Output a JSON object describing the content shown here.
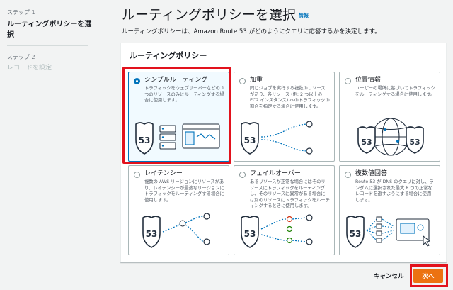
{
  "sidebar": {
    "steps": [
      {
        "label": "ステップ 1",
        "name": "ルーティングポリシーを選択"
      },
      {
        "label": "ステップ 2",
        "name": "レコードを設定"
      }
    ]
  },
  "header": {
    "title": "ルーティングポリシーを選択",
    "info": "情報",
    "description": "ルーティングポリシーは、Amazon Route 53 がどのようにクエリに応答するかを決定します。"
  },
  "panel": {
    "title": "ルーティングポリシー",
    "badge": "53",
    "options": [
      {
        "title": "シンプルルーティング",
        "description": "トラフィックをウェブサーバーなどの 1 つのリソースのみにルーティングする場合に使用します。",
        "selected": true
      },
      {
        "title": "加重",
        "description": "同じジョブを実行する複数のリソースがあり、各リソース (例: 2 つ以上の EC2 インスタンス) へのトラフィックの割合を指定する場合に使用します。",
        "selected": false
      },
      {
        "title": "位置情報",
        "description": "ユーザーの場所に基づいてトラフィックをルーティングする場合に使用します。",
        "selected": false
      },
      {
        "title": "レイテンシー",
        "description": "複数の AWS リージョンにリソースがあり、レイテンシーが最適なリージョンにトラフィックをルーティングする場合に使用します。",
        "selected": false
      },
      {
        "title": "フェイルオーバー",
        "description": "あるリソースが正常な場合にはそのリソースにトラフィックをルーティングし、そのリソースに異常がある場合には別のリソースにトラフィックをルーティングするときに使用します。",
        "selected": false
      },
      {
        "title": "複数値回答",
        "description": "Route 53 が DNS のクエリに対し、ランダムに選択された最大 8 つの正常なレコードを返すようにする場合に使用します。",
        "selected": false
      }
    ]
  },
  "footer": {
    "cancel": "キャンセル",
    "next": "次へ"
  },
  "colors": {
    "accent": "#0073bb",
    "primary_button": "#ec7211",
    "highlight": "#e2121d"
  }
}
